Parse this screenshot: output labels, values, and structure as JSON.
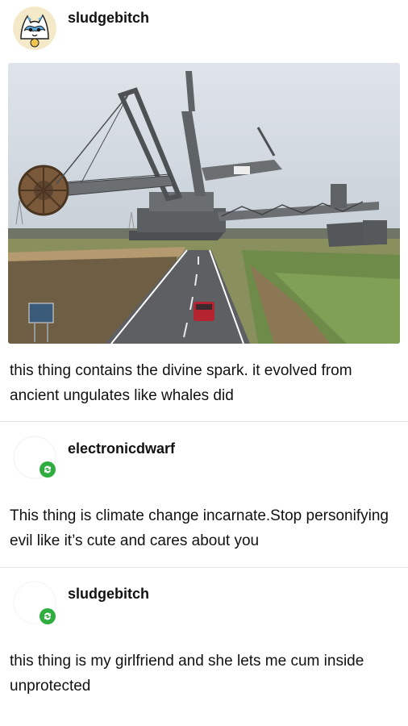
{
  "posts": [
    {
      "username": "sludgebitch",
      "text": "this thing contains the divine spark. it evolved from ancient ungulates like whales did"
    },
    {
      "username": "electronicdwarf",
      "text": "This thing is climate change incarnate.Stop personifying evil like it’s cute and cares about you"
    },
    {
      "username": "sludgebitch",
      "text": "this thing is my girlfriend and she lets me cum inside unprotected"
    }
  ],
  "photo": {
    "subject": "bucket-wheel-excavator"
  },
  "colors": {
    "reblog_green": "#2fae3f",
    "divider": "#e4e4e4"
  }
}
